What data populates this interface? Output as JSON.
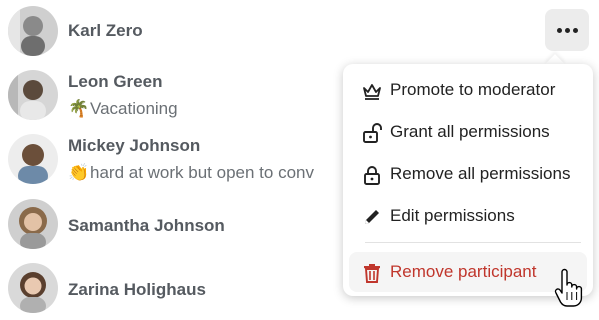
{
  "participants": [
    {
      "name": "Karl Zero",
      "status_emoji": "",
      "status_text": ""
    },
    {
      "name": "Leon Green",
      "status_emoji": "🌴",
      "status_text": "Vacationing"
    },
    {
      "name": "Mickey Johnson",
      "status_emoji": "👏",
      "status_text": "hard at work but open to conv"
    },
    {
      "name": "Samantha Johnson",
      "status_emoji": "",
      "status_text": ""
    },
    {
      "name": "Zarina Holighaus",
      "status_emoji": "",
      "status_text": ""
    }
  ],
  "menu": {
    "items": [
      {
        "label": "Promote to moderator",
        "icon": "crown-icon"
      },
      {
        "label": "Grant all permissions",
        "icon": "lock-open-icon"
      },
      {
        "label": "Remove all permissions",
        "icon": "lock-icon"
      },
      {
        "label": "Edit permissions",
        "icon": "pencil-icon"
      },
      {
        "label": "Remove participant",
        "icon": "trash-icon"
      }
    ]
  },
  "colors": {
    "danger": "#c0362c",
    "text": "#222222",
    "name": "#555a60"
  }
}
